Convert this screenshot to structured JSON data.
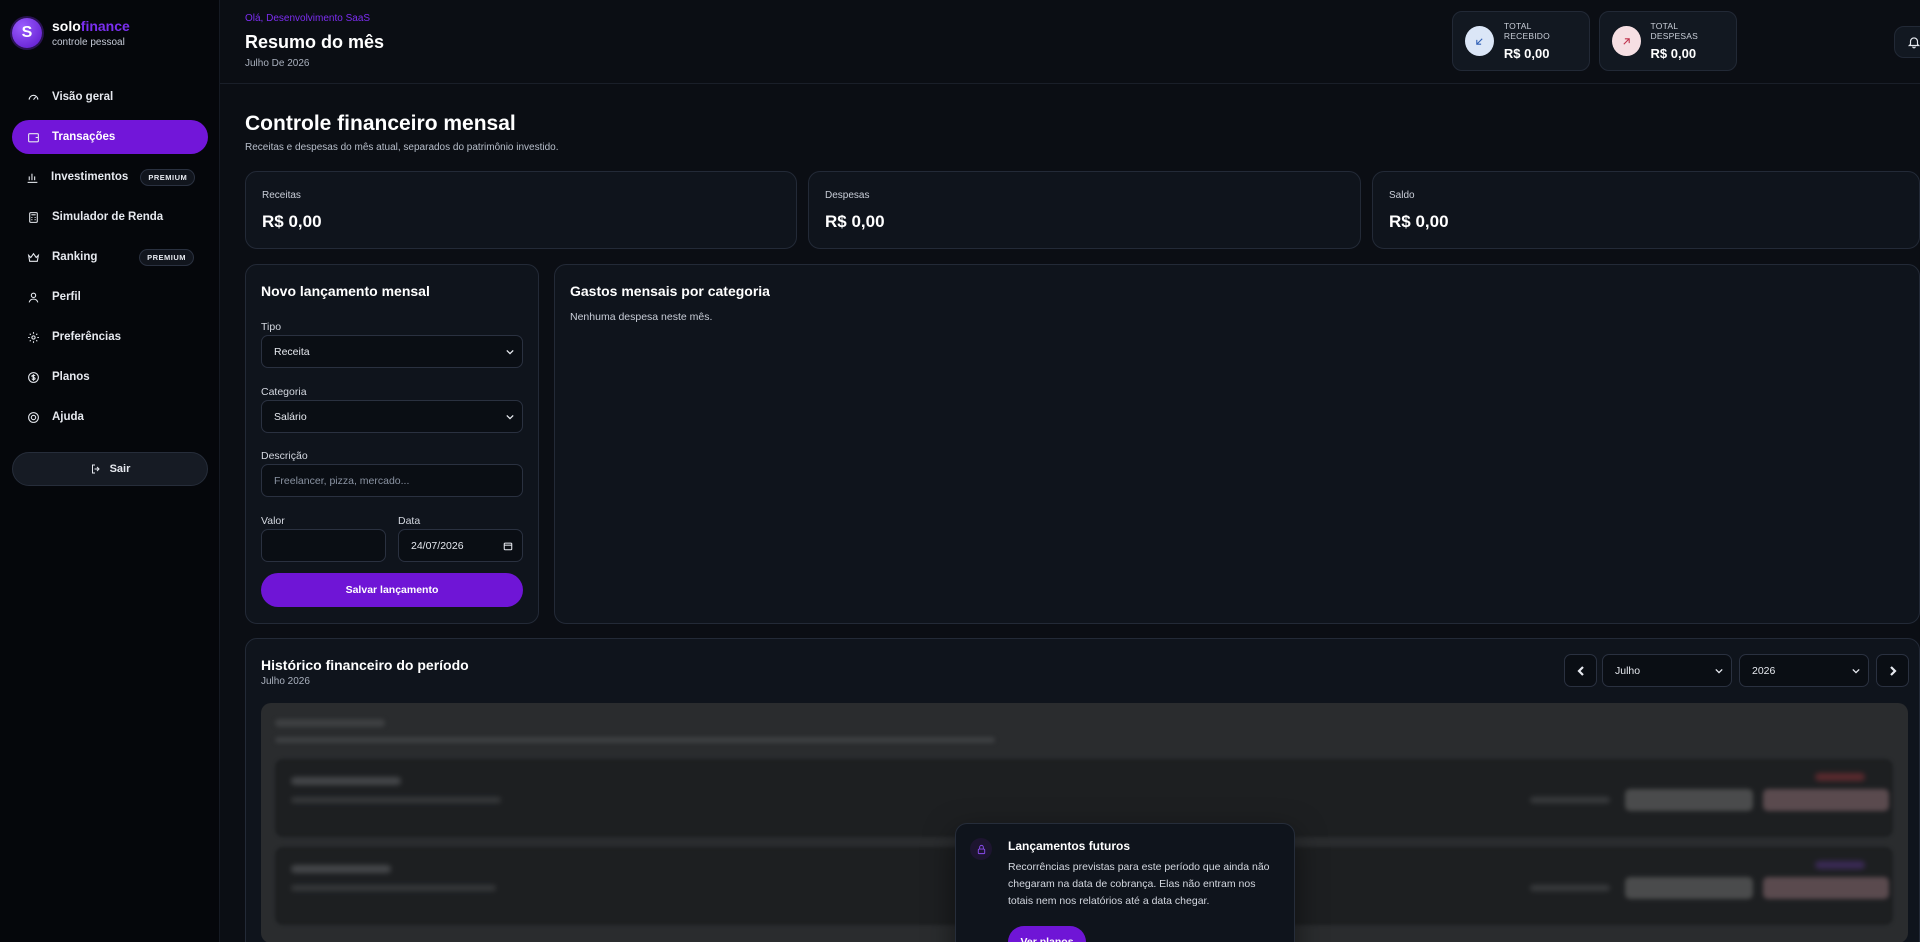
{
  "brand": {
    "name_main": "solo",
    "name_accent": "finance",
    "subtitle": "controle pessoal",
    "logo_letter": "S"
  },
  "sidebar": {
    "items": [
      {
        "label": "Visão geral",
        "icon": "gauge-icon",
        "active": false,
        "badge": ""
      },
      {
        "label": "Transações",
        "icon": "wallet-icon",
        "active": true,
        "badge": ""
      },
      {
        "label": "Investimentos",
        "icon": "chart-bar-icon",
        "active": false,
        "badge": "PREMIUM"
      },
      {
        "label": "Simulador de Renda",
        "icon": "calculator-icon",
        "active": false,
        "badge": ""
      },
      {
        "label": "Ranking",
        "icon": "crown-icon",
        "active": false,
        "badge": "PREMIUM"
      },
      {
        "label": "Perfil",
        "icon": "user-icon",
        "active": false,
        "badge": ""
      },
      {
        "label": "Preferências",
        "icon": "gear-icon",
        "active": false,
        "badge": ""
      },
      {
        "label": "Planos",
        "icon": "dollar-circle-icon",
        "active": false,
        "badge": ""
      },
      {
        "label": "Ajuda",
        "icon": "lifebuoy-icon",
        "active": false,
        "badge": ""
      }
    ],
    "logout_label": "Sair"
  },
  "header": {
    "greeting": "Olá, Desenvolvimento SaaS",
    "title": "Resumo do mês",
    "date": "Julho De 2026",
    "total_received_label": "TOTAL RECEBIDO",
    "total_received_value": "R$ 0,00",
    "total_expenses_label": "TOTAL DESPESAS",
    "total_expenses_value": "R$ 0,00"
  },
  "main": {
    "title": "Controle financeiro mensal",
    "subtitle": "Receitas e despesas do mês atual, separados do patrimônio investido.",
    "summary": [
      {
        "label": "Receitas",
        "value": "R$ 0,00"
      },
      {
        "label": "Despesas",
        "value": "R$ 0,00"
      },
      {
        "label": "Saldo",
        "value": "R$ 0,00"
      }
    ]
  },
  "form": {
    "title": "Novo lançamento mensal",
    "type_label": "Tipo",
    "type_value": "Receita",
    "category_label": "Categoria",
    "category_value": "Salário",
    "description_label": "Descrição",
    "description_placeholder": "Freelancer, pizza, mercado...",
    "value_label": "Valor",
    "value_value": "",
    "date_label": "Data",
    "date_value": "24/07/2026",
    "save_label": "Salvar lançamento"
  },
  "categories": {
    "title": "Gastos mensais por categoria",
    "empty_text": "Nenhuma despesa neste mês."
  },
  "history": {
    "title": "Histórico financeiro do período",
    "subtitle": "Julho 2026",
    "month_value": "Julho",
    "year_value": "2026"
  },
  "locked_popup": {
    "title": "Lançamentos futuros",
    "text": "Recorrências previstas para este período que ainda não chegaram na data de cobrança. Elas não entram nos totais nem nos relatórios até a data chegar.",
    "button_label": "Ver planos"
  },
  "colors": {
    "accent": "#7216d9",
    "background": "#0b0e14",
    "card": "#0f141c",
    "sidebar": "#05070b"
  }
}
